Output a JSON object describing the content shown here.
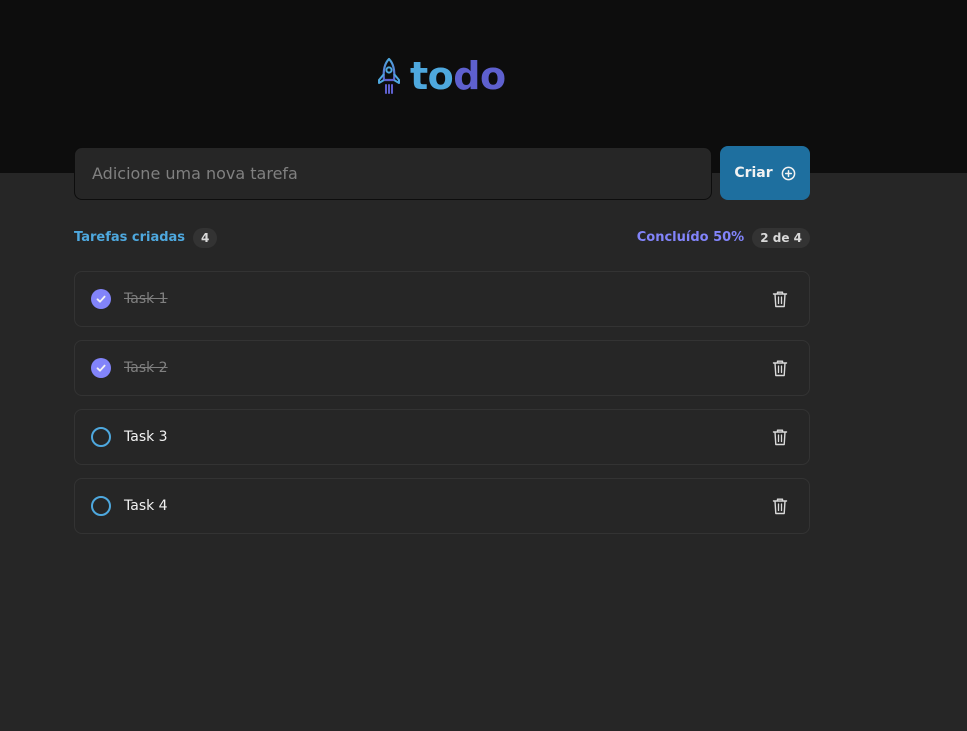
{
  "app": {
    "logo_part1": "to",
    "logo_part2": "do",
    "colors": {
      "blue": "#4ea8de",
      "purple": "#5e60ce",
      "purple_light": "#8284fa",
      "button": "#1e6f9f"
    }
  },
  "new_task": {
    "placeholder": "Adicione uma nova tarefa",
    "value": "",
    "create_label": "Criar",
    "create_icon": "plus-circle-icon"
  },
  "info": {
    "created_label": "Tarefas criadas",
    "created_count": "4",
    "done_label": "Concluído 50%",
    "done_count": "2 de 4"
  },
  "tasks": [
    {
      "text": "Task 1",
      "done": true
    },
    {
      "text": "Task 2",
      "done": true
    },
    {
      "text": "Task 3",
      "done": false
    },
    {
      "text": "Task 4",
      "done": false
    }
  ]
}
